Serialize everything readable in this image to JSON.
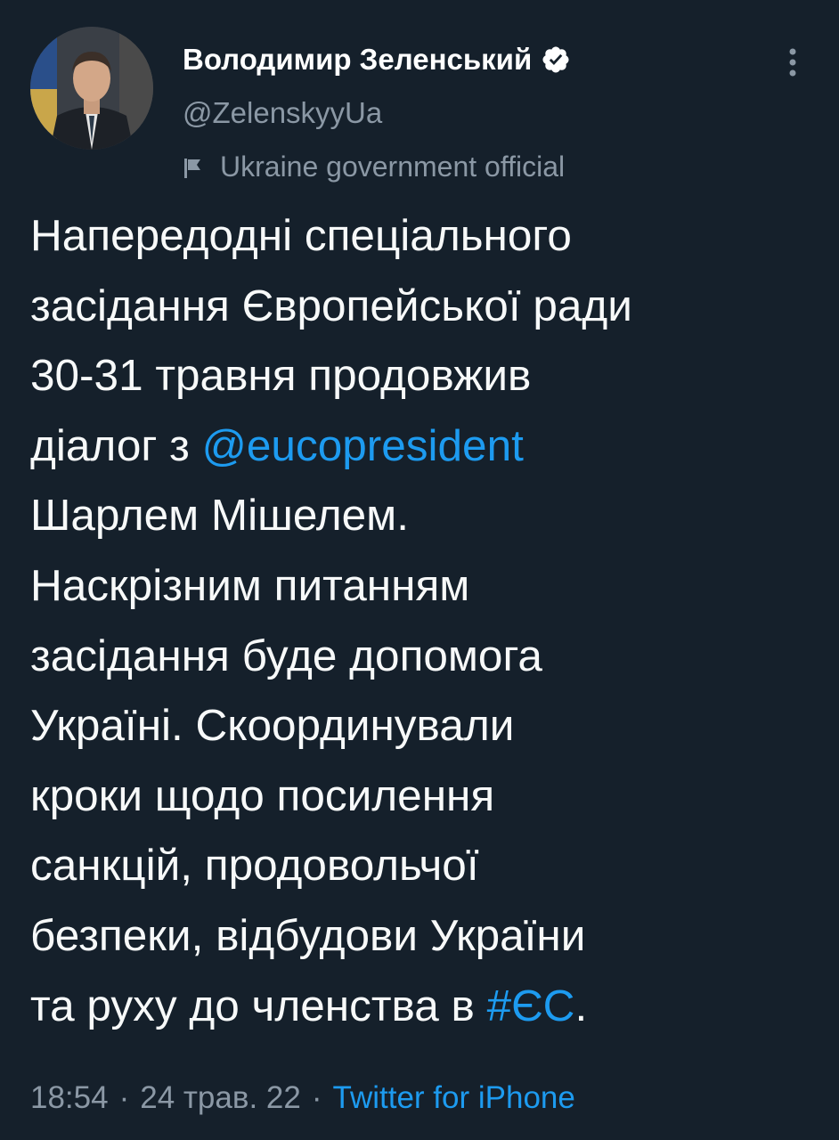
{
  "author": {
    "display_name": "Володимир Зеленський",
    "handle": "@ZelenskyyUa",
    "verified": true,
    "label": "Ukraine government official",
    "verified_icon": "verified-badge-icon",
    "label_icon": "flag-icon",
    "avatar_icon": "avatar"
  },
  "menu": {
    "icon": "more-vertical-icon"
  },
  "tweet": {
    "lines": [
      {
        "text": "Напередодні спеціального"
      },
      {
        "text": "засідання Європейської ради"
      },
      {
        "text": "30-31 травня продовжив"
      },
      {
        "before": "діалог з ",
        "mention": "@eucopresident"
      },
      {
        "text": "Шарлем Мішелем."
      },
      {
        "text": "Наскрізним питанням"
      },
      {
        "text": "засідання буде допомога"
      },
      {
        "text": "Україні. Скоординували"
      },
      {
        "text": "кроки щодо посилення"
      },
      {
        "text": "санкцій, продовольчої"
      },
      {
        "text": "безпеки, відбудови України"
      },
      {
        "before": "та руху до членства в ",
        "hashtag": "#ЄС",
        "after": "."
      }
    ]
  },
  "meta": {
    "time": "18:54",
    "separator": "·",
    "date": "24 трав. 22",
    "source": "Twitter for iPhone"
  },
  "colors": {
    "background": "#15202b",
    "text": "#f7f9f9",
    "secondary": "#8b98a5",
    "accent": "#1d9bf0"
  }
}
